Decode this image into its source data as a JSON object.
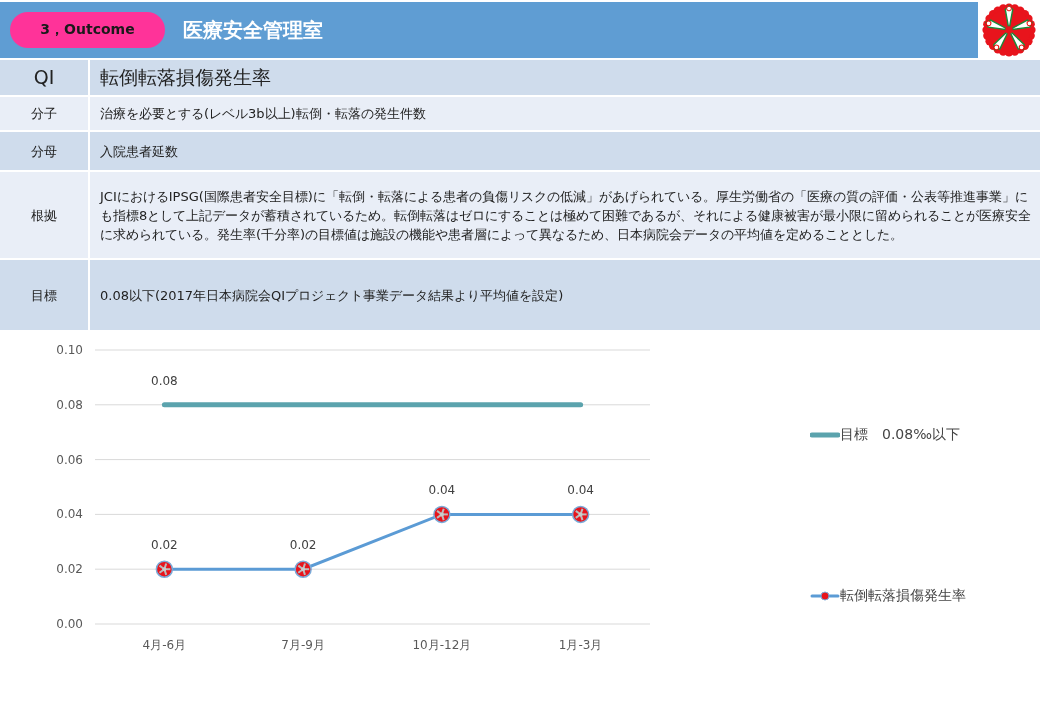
{
  "header": {
    "badge": "3，Outcome",
    "title": "医療安全管理室"
  },
  "table": {
    "rows": [
      {
        "kind": "heading",
        "label": "QI",
        "value": "転倒転落損傷発生率"
      },
      {
        "kind": "field",
        "label": "分子",
        "value": "治療を必要とする(レベル3b以上)転倒・転落の発生件数"
      },
      {
        "kind": "field",
        "label": "分母",
        "value": "入院患者延数"
      },
      {
        "kind": "field",
        "label": "根拠",
        "value": "JCIにおけるIPSG(国際患者安全目標)に「転倒・転落による患者の負傷リスクの低減」があげられている。厚生労働省の「医療の質の評価・公表等推進事業」にも指標8として上記データが蓄積されているため。転倒転落はゼロにすることは極めて困難であるが、それによる健康被害が最小限に留められることが医療安全に求められている。発生率(千分率)の目標値は施設の機能や患者層によって異なるため、日本病院会データの平均値を定めることとした。"
      },
      {
        "kind": "field",
        "label": "目標",
        "value": "0.08以下(2017年日本病院会QIプロジェクト事業データ結果より平均値を設定)"
      }
    ]
  },
  "chart_data": {
    "type": "line",
    "categories": [
      "4月-6月",
      "7月-9月",
      "10月-12月",
      "1月-3月"
    ],
    "series": [
      {
        "name": "目標　0.08‰以下",
        "color": "#5ba3ad",
        "values": [
          0.08,
          0.08,
          0.08,
          0.08
        ]
      },
      {
        "name": "転倒転落損傷発生率",
        "color": "#5b9bd5",
        "marker": "circle",
        "values": [
          0.02,
          0.02,
          0.04,
          0.04
        ]
      }
    ],
    "grid": true,
    "ylim": [
      0,
      0.1
    ],
    "yticks": [
      {
        "value": 0,
        "label": "0.00"
      },
      {
        "value": 0.02,
        "label": "0.02"
      },
      {
        "value": 0.04,
        "label": "0.04"
      },
      {
        "value": 0.06,
        "label": "0.06"
      },
      {
        "value": 0.08,
        "label": "0.08"
      },
      {
        "value": 0.1,
        "label": "0.10"
      }
    ],
    "value_labels": [
      [
        "0.08",
        null,
        null,
        null
      ],
      [
        "0.02",
        "0.02",
        "0.04",
        "0.04"
      ]
    ]
  }
}
